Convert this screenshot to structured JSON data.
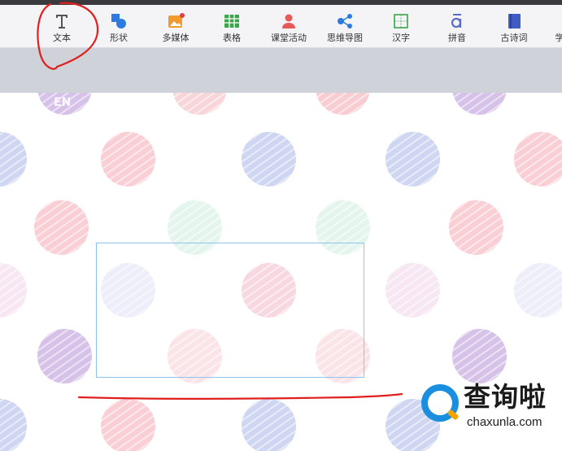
{
  "toolbar": {
    "items": [
      {
        "label": "文本",
        "icon": "text-t-icon"
      },
      {
        "label": "形状",
        "icon": "shape-icon"
      },
      {
        "label": "多媒体",
        "icon": "media-image-icon"
      },
      {
        "label": "表格",
        "icon": "table-icon"
      },
      {
        "label": "课堂活动",
        "icon": "classroom-activity-icon"
      },
      {
        "label": "思维导图",
        "icon": "mind-map-icon"
      },
      {
        "label": "汉字",
        "icon": "chinese-character-grid-icon"
      },
      {
        "label": "拼音",
        "icon": "pinyin-icon"
      },
      {
        "label": "古诗词",
        "icon": "poetry-book-icon"
      },
      {
        "label": "学",
        "icon": "study-icon"
      }
    ]
  },
  "canvas": {
    "slide_badge": "EN"
  },
  "watermark": {
    "title": "查询啦",
    "site": "chaxunla.com"
  },
  "colors": {
    "toolbar_bg": "#f4f4f6",
    "subbar_bg": "#d0d2da",
    "textbox_border": "#8fc3f0",
    "annotation_red": "#e0201f",
    "watermark_blue": "#1a8fe0",
    "watermark_orange": "#f5a300"
  }
}
